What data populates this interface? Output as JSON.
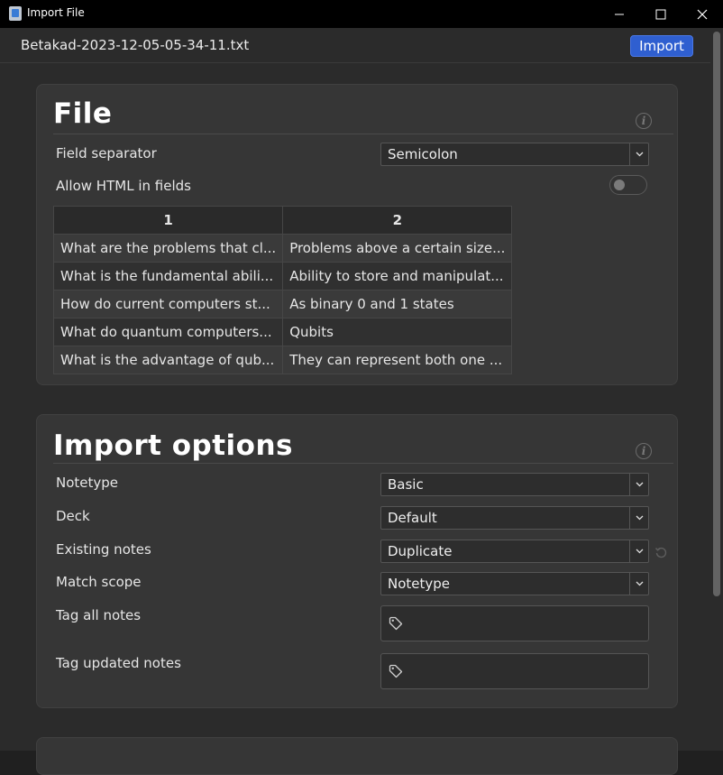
{
  "window": {
    "title": "Import File",
    "app_icon": "app-icon",
    "minimize_icon": "minimize-icon",
    "maximize_icon": "maximize-icon",
    "close_icon": "close-icon"
  },
  "header": {
    "file_name": "Betakad-2023-12-05-05-34-11.txt",
    "import_label": "Import"
  },
  "file_section": {
    "title": "File",
    "info_icon": "info-icon",
    "field_separator": {
      "label": "Field separator",
      "value": "Semicolon"
    },
    "allow_html": {
      "label": "Allow HTML in fields",
      "enabled": false
    },
    "preview": {
      "columns": [
        "1",
        "2"
      ],
      "rows": [
        [
          "What are the problems that cl...",
          "Problems above a certain size..."
        ],
        [
          "What is the fundamental abili...",
          "Ability to store and manipulat..."
        ],
        [
          "How do current computers st...",
          "As binary 0 and 1 states"
        ],
        [
          "What do quantum computers...",
          "Qubits"
        ],
        [
          "What is the advantage of qub...",
          "They can represent both one ..."
        ]
      ]
    }
  },
  "import_options": {
    "title": "Import options",
    "info_icon": "info-icon",
    "notetype": {
      "label": "Notetype",
      "value": "Basic"
    },
    "deck": {
      "label": "Deck",
      "value": "Default"
    },
    "existing_notes": {
      "label": "Existing notes",
      "value": "Duplicate",
      "revert_icon": "revert-icon"
    },
    "match_scope": {
      "label": "Match scope",
      "value": "Notetype"
    },
    "tag_all_notes": {
      "label": "Tag all notes",
      "icon": "tag-icon"
    },
    "tag_updated_notes": {
      "label": "Tag updated notes",
      "icon": "tag-icon"
    }
  },
  "colors": {
    "accent": "#2f5fd0",
    "background": "#2b2b2b",
    "card": "#363636",
    "titlebar": "#000000"
  }
}
